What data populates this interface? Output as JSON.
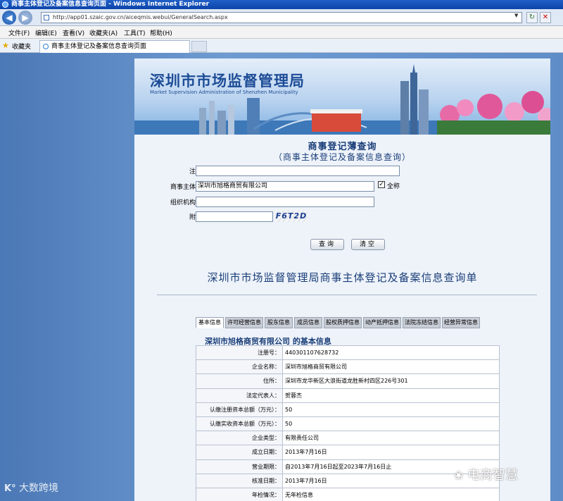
{
  "window": {
    "title": "商事主体登记及备案信息查询页面 - Windows Internet Explorer",
    "url": "http://app01.szaic.gov.cn/aiceqmis.webui/GeneralSearch.aspx"
  },
  "menu": [
    "文件(F)",
    "编辑(E)",
    "查看(V)",
    "收藏夹(A)",
    "工具(T)",
    "帮助(H)"
  ],
  "favorites": {
    "label": "收藏夹",
    "tab_label": "商事主体登记及备案信息查询页面"
  },
  "banner": {
    "title": "深圳市市场监督管理局",
    "subtitle": "Market Supervision Administration of Shenzhen Municipality"
  },
  "form": {
    "title": "商事登记薄查询",
    "subtitle": "（商事主体登记及备案信息查询）",
    "reg_no_label": "注册号:",
    "name_label": "商事主体名称:",
    "name_value": "深圳市旭格商贸有限公司",
    "fullname_label": "全称",
    "org_code_label": "组织机构代码:",
    "extra_code_label": "附加码:",
    "captcha": "F6T2D",
    "search_btn": "查询",
    "clear_btn": "清空"
  },
  "report": {
    "title": "深圳市市场监督管理局商事主体登记及备案信息查询单",
    "tabs": [
      "基本信息",
      "许可经营信息",
      "股东信息",
      "成员信息",
      "股权质押信息",
      "动产抵押信息",
      "法院冻结信息",
      "经营异常信息"
    ],
    "info_title": "深圳市旭格商贸有限公司 的基本信息",
    "rows": [
      {
        "k": "注册号：",
        "v": "440301107628732"
      },
      {
        "k": "企业名称：",
        "v": "深圳市旭格商贸有限公司"
      },
      {
        "k": "住所：",
        "v": "深圳市龙华新区大浪街道龙胜新村四区226号301"
      },
      {
        "k": "法定代表人：",
        "v": "贺蓉杰"
      },
      {
        "k": "认缴注册资本总额（万元）：",
        "v": "50"
      },
      {
        "k": "认缴实收资本总额（万元）：",
        "v": "50"
      },
      {
        "k": "企业类型：",
        "v": "有限责任公司"
      },
      {
        "k": "成立日期：",
        "v": "2013年7月16日"
      },
      {
        "k": "营业期限：",
        "v": "自2013年7月16日起至2023年7月16日止"
      },
      {
        "k": "核准日期：",
        "v": "2013年7月16日"
      },
      {
        "k": "年检情况：",
        "v": "无年检信息"
      }
    ]
  },
  "watermarks": {
    "left": "大数跨境",
    "right": "电商智慧"
  }
}
